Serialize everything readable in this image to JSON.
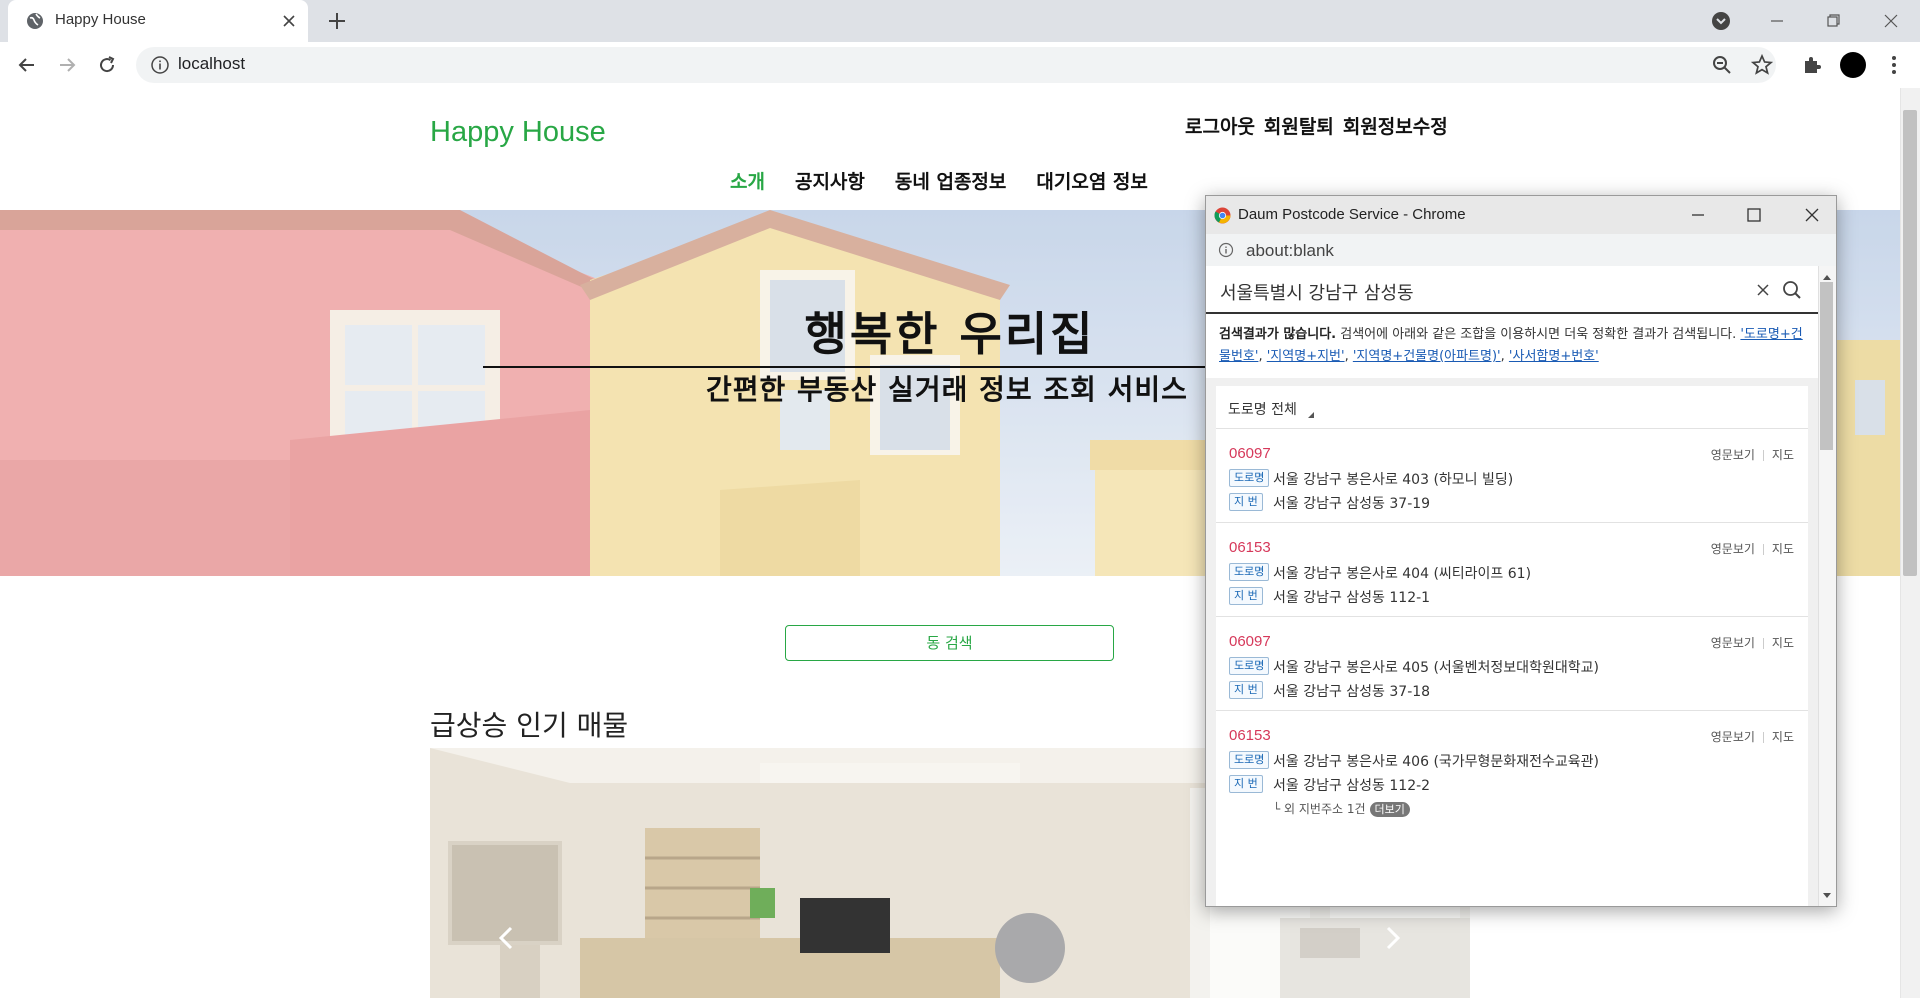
{
  "browser": {
    "tab_title": "Happy House",
    "url": "localhost"
  },
  "site": {
    "brand": "Happy House",
    "auth_links": [
      "로그아웃",
      "회원탈퇴",
      "회원정보수정"
    ],
    "nav": [
      {
        "label": "소개",
        "active": true
      },
      {
        "label": "공지사항",
        "active": false
      },
      {
        "label": "동네 업종정보",
        "active": false
      },
      {
        "label": "대기오염 정보",
        "active": false
      }
    ],
    "hero_title": "행복한 우리집",
    "hero_subtitle": "간편한 부동산 실거래 정보 조회 서비스",
    "dong_search_button": "동 검색",
    "section_title": "급상승 인기 매물"
  },
  "popup": {
    "window_title": "Daum Postcode Service - Chrome",
    "url": "about:blank",
    "query": "서울특별시 강남구 삼성동",
    "tip_bold": "검색결과가 많습니다.",
    "tip_text": "검색어에 아래와 같은 조합을 이용하시면 더욱 정확한 결과가 검색됩니다.",
    "tip_examples": [
      "'도로명+건물번호'",
      "'지역명+지번'",
      "'지역명+건물명(아파트명)'",
      "'사서함명+번호'"
    ],
    "filter_label": "도로명 전체",
    "result_links": {
      "english": "영문보기",
      "map": "지도"
    },
    "badges": {
      "road": "도로명",
      "jibun": "지 번"
    },
    "results": [
      {
        "zip": "06097",
        "road": "서울 강남구 봉은사로 403 (하모니 빌딩)",
        "jibun": "서울 강남구 삼성동 37-19"
      },
      {
        "zip": "06153",
        "road": "서울 강남구 봉은사로 404 (씨티라이프 61)",
        "jibun": "서울 강남구 삼성동 112-1"
      },
      {
        "zip": "06097",
        "road": "서울 강남구 봉은사로 405 (서울벤처정보대학원대학교)",
        "jibun": "서울 강남구 삼성동 37-18"
      },
      {
        "zip": "06153",
        "road": "서울 강남구 봉은사로 406 (국가무형문화재전수교육관)",
        "jibun": "서울 강남구 삼성동 112-2"
      }
    ],
    "extra_jibun_text": "└ 외 지번주소 1건",
    "extra_more_label": "더보기"
  },
  "colors": {
    "brand_green": "#28a745",
    "zip_red": "#d6385a",
    "link_blue": "#1a5bb4"
  },
  "icons": [
    "globe-icon",
    "close-icon",
    "plus-icon",
    "back-icon",
    "forward-icon",
    "reload-icon",
    "info-icon",
    "zoom-out-icon",
    "star-icon",
    "puzzle-icon",
    "kebab-menu-icon",
    "chrome-logo-icon",
    "search-icon",
    "chevron-left-icon",
    "chevron-right-icon"
  ]
}
